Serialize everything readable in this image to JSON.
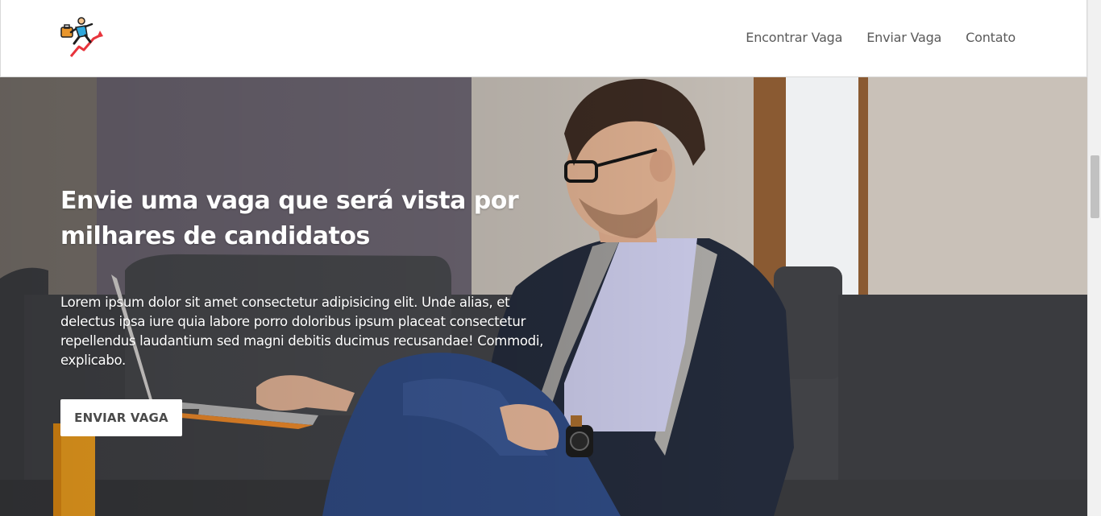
{
  "header": {
    "logo_icon": "runner-climbing-chart-icon",
    "nav": [
      {
        "label": "Encontrar Vaga"
      },
      {
        "label": "Enviar Vaga"
      },
      {
        "label": "Contato"
      }
    ]
  },
  "hero": {
    "title": "Envie uma vaga que será vista por milhares de candidatos",
    "text": "Lorem ipsum dolor sit amet consectetur adipisicing elit. Unde alias, et delectus ipsa iure quia labore porro doloribus ipsum placeat consectetur repellendus laudantium sed magni debitis ducimus recusandae! Commodi, explicabo.",
    "button_label": "ENVIAR VAGA",
    "background_image": "man-with-laptop-on-sofa-photo"
  },
  "colors": {
    "nav_text": "#5a5a5a",
    "hero_text": "#ffffff",
    "button_bg": "#ffffff",
    "button_text": "#4a4a4a"
  }
}
